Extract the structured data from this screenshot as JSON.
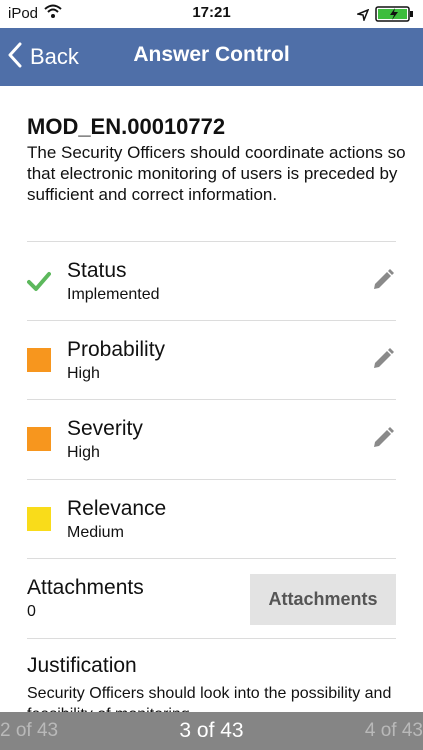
{
  "status_bar": {
    "carrier": "iPod",
    "time": "17:21",
    "icons": [
      "wifi-icon",
      "location-icon",
      "battery-charging-icon"
    ]
  },
  "nav": {
    "back_label": "Back",
    "title": "Answer Control",
    "bar_color": "#4f6fa8"
  },
  "question": {
    "code": "MOD_EN.00010772",
    "text": "The Security Officers should coordinate actions so that electronic monitoring of users is preceded by sufficient and correct information."
  },
  "rows": [
    {
      "title": "Status",
      "value": "Implemented",
      "indicator": "check-icon",
      "color": "#5cb85c",
      "editable": true
    },
    {
      "title": "Probability",
      "value": "High",
      "indicator": "square",
      "color": "#f7961e",
      "editable": true
    },
    {
      "title": "Severity",
      "value": "High",
      "indicator": "square",
      "color": "#f7961e",
      "editable": true
    },
    {
      "title": "Relevance",
      "value": "Medium",
      "indicator": "square",
      "color": "#f9dc1a",
      "editable": false
    }
  ],
  "attachments": {
    "title": "Attachments",
    "count": "0",
    "button_label": "Attachments"
  },
  "justification": {
    "title": "Justification",
    "text": "Security Officers should look into the possibility and feasibility of monitoring"
  },
  "pager": {
    "prev": "2 of 43",
    "current": "3 of 43",
    "next": "4 of 43"
  }
}
